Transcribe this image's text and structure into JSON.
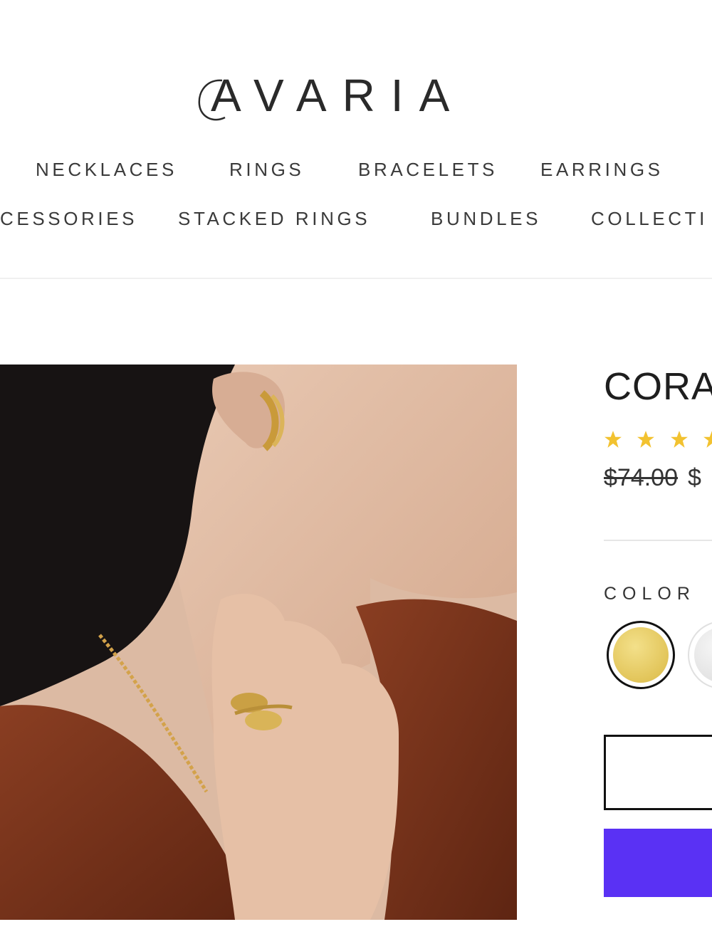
{
  "brand": {
    "name": "AVARIA"
  },
  "nav": {
    "row1": [
      "NECKLACES",
      "RINGS",
      "BRACELETS",
      "EARRINGS"
    ],
    "row2": [
      "CESSORIES",
      "STACKED RINGS",
      "BUNDLES",
      "COLLECTI"
    ]
  },
  "product": {
    "title": "CORA",
    "rating_stars_visible": 4,
    "compare_price": "$74.00",
    "sale_price": "$",
    "color_label": "COLOR",
    "colors": [
      {
        "name": "gold",
        "hex": "#E2C55A",
        "selected": true
      },
      {
        "name": "silver",
        "hex": "#E3E3E3",
        "selected": false
      }
    ]
  },
  "theme": {
    "accent": "#5A31F4",
    "star": "#F2C230"
  }
}
